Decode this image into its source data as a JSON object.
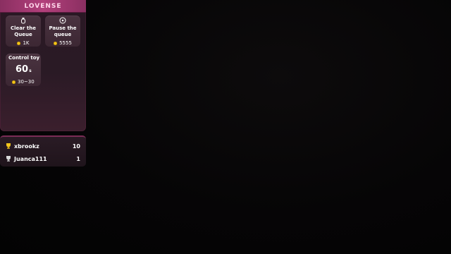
{
  "brand": "LOVENSE",
  "actions": [
    {
      "title_line1": "Clear the",
      "title_line2": "Queue",
      "price": "1K",
      "icon": "toy-icon"
    },
    {
      "title_line1": "Pause the",
      "title_line2": "queue",
      "price": "5555",
      "icon": "pause-circle-icon"
    }
  ],
  "control": {
    "title": "Control toy",
    "amount": "60",
    "unit": "s",
    "price": "30~30"
  },
  "leaderboard": [
    {
      "name": "xbrookz",
      "score": "10"
    },
    {
      "name": "Juanca111",
      "score": "1"
    }
  ],
  "colors": {
    "accent": "#b2407b",
    "coin": "#f3c51b",
    "panel": "#2a1824"
  }
}
